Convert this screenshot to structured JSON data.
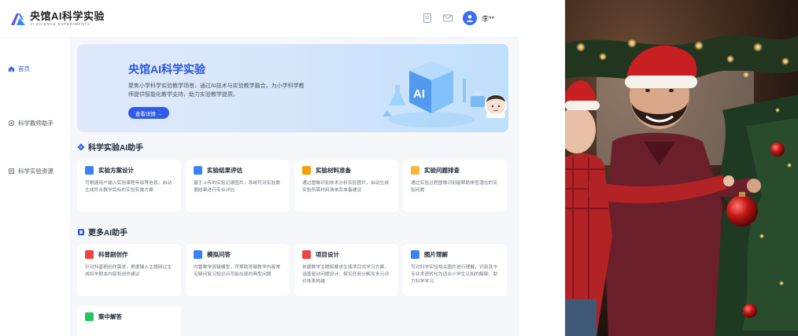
{
  "header": {
    "logo_title": "央馆AI科学实验",
    "logo_subtitle": "AI SCIENCE EXPERIMENTS",
    "user_name": "李**"
  },
  "sidebar": {
    "items": [
      {
        "label": "首页",
        "icon": "home-icon",
        "active": true
      },
      {
        "label": "科学教师助手",
        "icon": "teacher-icon",
        "active": false
      },
      {
        "label": "科学实验资源",
        "icon": "resource-icon",
        "active": false
      }
    ]
  },
  "banner": {
    "title": "央馆AI科学实验",
    "description": "聚焦小学科学实验教学场景，通过AI技术与实验教学融合，为小学科学教师提供智能化教学支持，助力实验教学提质。",
    "button_label": "查看详情 →"
  },
  "sections": [
    {
      "title": "科学实验AI助手",
      "cards": [
        {
          "title": "实验方案设计",
          "icon": "plan-icon",
          "icon_color": "#3b82f6",
          "description": "可根据用户输入实验课程年级等信息，自动生成符合教学目标的实验实施方案"
        },
        {
          "title": "实验结果评估",
          "icon": "evaluate-icon",
          "icon_color": "#3b82f6",
          "description": "基于上传的实验记录图片，系统可对实验数据结果进行专业评估"
        },
        {
          "title": "实验材料准备",
          "icon": "material-icon",
          "icon_color": "#f59e0b",
          "description": "通过图像识别技术分析实验图片，自动生成实验所需材料清单及准备建议"
        },
        {
          "title": "实验问题排查",
          "icon": "troubleshoot-icon",
          "icon_color": "#f5b841",
          "description": "通过实验过程图像识别能帮助排查潜在的实验问题"
        }
      ]
    },
    {
      "title": "更多AI助手",
      "cards": [
        {
          "title": "科普剧创作",
          "icon": "drama-icon",
          "icon_color": "#ef4444",
          "description": "针对科普剧创作需求，根据输入主题网过生成科学剧本内容和创作建议"
        },
        {
          "title": "模拟问答",
          "icon": "qa-icon",
          "icon_color": "#3b82f6",
          "description": "内置教学答疑模型，可帮助答疑教学内容常见疑问复习知识点可能出现的典型问题"
        },
        {
          "title": "项目设计",
          "icon": "project-icon",
          "icon_color": "#ef4444",
          "description": "依据教学主题和要求生成项目式学习方案，涵盖驱动问题设计、探究任务分解及多元评价体系构建"
        },
        {
          "title": "图片理解",
          "icon": "image-icon",
          "icon_color": "#3b82f6",
          "description": "可对科学实验相关图片进行理解，识别其中专业术语转化为适合小学生认知的解释，助力科学学习"
        },
        {
          "title": "案中解答",
          "icon": "answer-icon",
          "icon_color": "#22c55e",
          "description": ""
        }
      ]
    }
  ],
  "colors": {
    "accent": "#2f5be8",
    "banner_bg": "#d7e6fa",
    "page_bg": "#f5f7fb"
  }
}
